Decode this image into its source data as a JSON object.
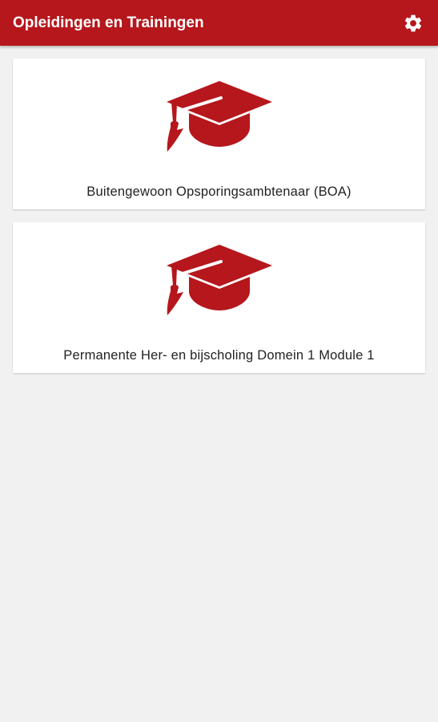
{
  "app_bar": {
    "title": "Opleidingen en Trainingen",
    "settings_icon": "gear-icon",
    "background_color": "#b5171c",
    "title_color": "#ffffff"
  },
  "courses": [
    {
      "label": "Buitengewoon Opsporingsambtenaar (BOA)",
      "icon": "graduation-cap-icon"
    },
    {
      "label": "Permanente Her- en bijscholing Domein 1 Module 1",
      "icon": "graduation-cap-icon"
    }
  ],
  "theme": {
    "accent": "#b5171c",
    "background": "#f1f1f1",
    "card": "#ffffff"
  }
}
